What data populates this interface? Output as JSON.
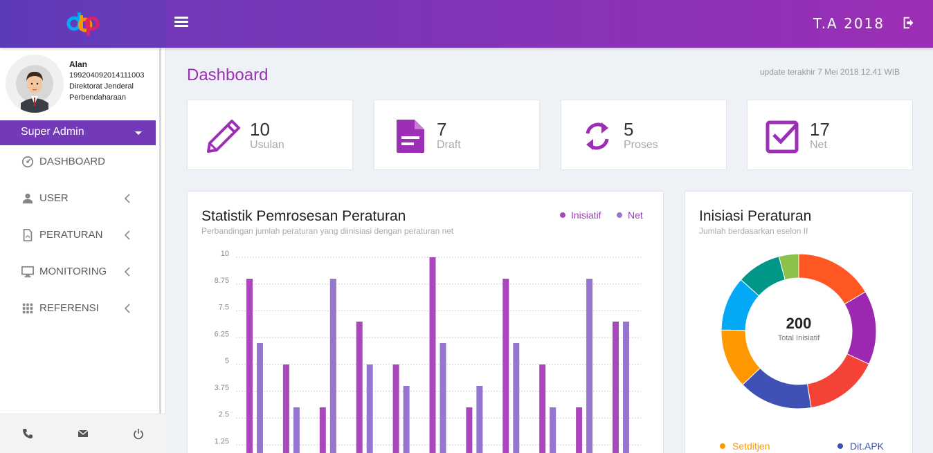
{
  "header": {
    "fiscal_year": "T.A 2018",
    "brand_colors": [
      "#5d3ab8",
      "#9c2fb5"
    ]
  },
  "profile": {
    "name": "Alan",
    "nip": "199204092014111003",
    "unit_line1": "Direktorat Jenderal",
    "unit_line2": "Perbendaharaan"
  },
  "role": {
    "label": "Super Admin"
  },
  "menu": [
    {
      "label": "DASHBOARD",
      "icon": "dashboard-icon"
    },
    {
      "label": "USER",
      "icon": "user-icon"
    },
    {
      "label": "PERATURAN",
      "icon": "pdf-file-icon"
    },
    {
      "label": "MONITORING",
      "icon": "monitor-icon"
    },
    {
      "label": "REFERENSI",
      "icon": "grid-icon"
    }
  ],
  "page": {
    "title": "Dashboard",
    "last_update": "update terakhir 7 Mei 2018 12.41 WIB"
  },
  "stats": [
    {
      "value": "10",
      "label": "Usulan",
      "icon": "pencil-icon"
    },
    {
      "value": "7",
      "label": "Draft",
      "icon": "document-icon"
    },
    {
      "value": "5",
      "label": "Proses",
      "icon": "refresh-icon"
    },
    {
      "value": "17",
      "label": "Net",
      "icon": "checkbox-icon"
    }
  ],
  "bar_panel": {
    "title": "Statistik Pemrosesan Peraturan",
    "subtitle": "Perbandingan jumlah peraturan yang diinisiasi dengan peraturan net"
  },
  "donut_panel": {
    "title": "Inisiasi Peraturan",
    "subtitle": "Jumlah berdasarkan eselon II",
    "center_value": "200",
    "center_label": "Total Inisiatif",
    "legend_visible": [
      {
        "label": "Setditjen",
        "color": "#ff9800"
      },
      {
        "label": "Dit.APK",
        "color": "#3f51b5"
      }
    ]
  },
  "chart_data": [
    {
      "type": "bar",
      "title": "Statistik Pemrosesan Peraturan",
      "subtitle": "Perbandingan jumlah peraturan yang diinisiasi dengan peraturan net",
      "y_ticks": [
        "10",
        "8.75",
        "7.5",
        "6.25",
        "5",
        "3.75",
        "2.5",
        "1.25"
      ],
      "ylim": [
        0,
        10
      ],
      "grid": true,
      "legend_position": "top-right",
      "series": [
        {
          "name": "Inisiatif",
          "color": "#ab47bc",
          "values": [
            9,
            5,
            3,
            7,
            5,
            10,
            3,
            9,
            5,
            3,
            7
          ]
        },
        {
          "name": "Net",
          "color": "#9575cd",
          "values": [
            6,
            3,
            9,
            5,
            4,
            6,
            4,
            6,
            3,
            9,
            7
          ]
        }
      ]
    },
    {
      "type": "pie",
      "title": "Inisiasi Peraturan",
      "subtitle": "Jumlah berdasarkan eselon II",
      "total": 200,
      "slices": [
        {
          "color": "#ff5722",
          "value": 32
        },
        {
          "color": "#9c27b0",
          "value": 30
        },
        {
          "color": "#f44336",
          "value": 30
        },
        {
          "color": "#3f51b5",
          "value": 30
        },
        {
          "color": "#ff9800",
          "value": 24
        },
        {
          "color": "#03a9f4",
          "value": 22
        },
        {
          "color": "#009688",
          "value": 18
        },
        {
          "color": "#8bc34a",
          "value": 8
        }
      ]
    }
  ]
}
